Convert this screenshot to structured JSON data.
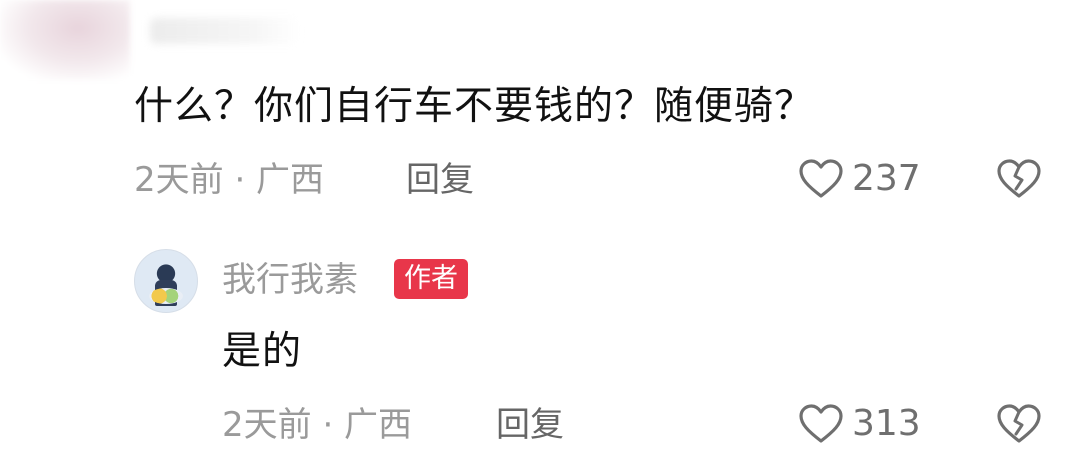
{
  "comment": {
    "text": "什么？你们自行车不要钱的？随便骑？",
    "meta": "2天前 · 广西",
    "reply_label": "回复",
    "like_count": "237"
  },
  "reply": {
    "author": "我行我素",
    "author_badge": "作者",
    "text": "是的",
    "meta": "2天前 · 广西",
    "reply_label": "回复",
    "like_count": "313"
  },
  "icons": {
    "like": "heart-icon",
    "dislike": "broken-heart-icon",
    "avatar": "user-avatar"
  },
  "colors": {
    "badge": "#e8364a",
    "meta_text": "#9a9a9a",
    "body_text": "#111111"
  }
}
